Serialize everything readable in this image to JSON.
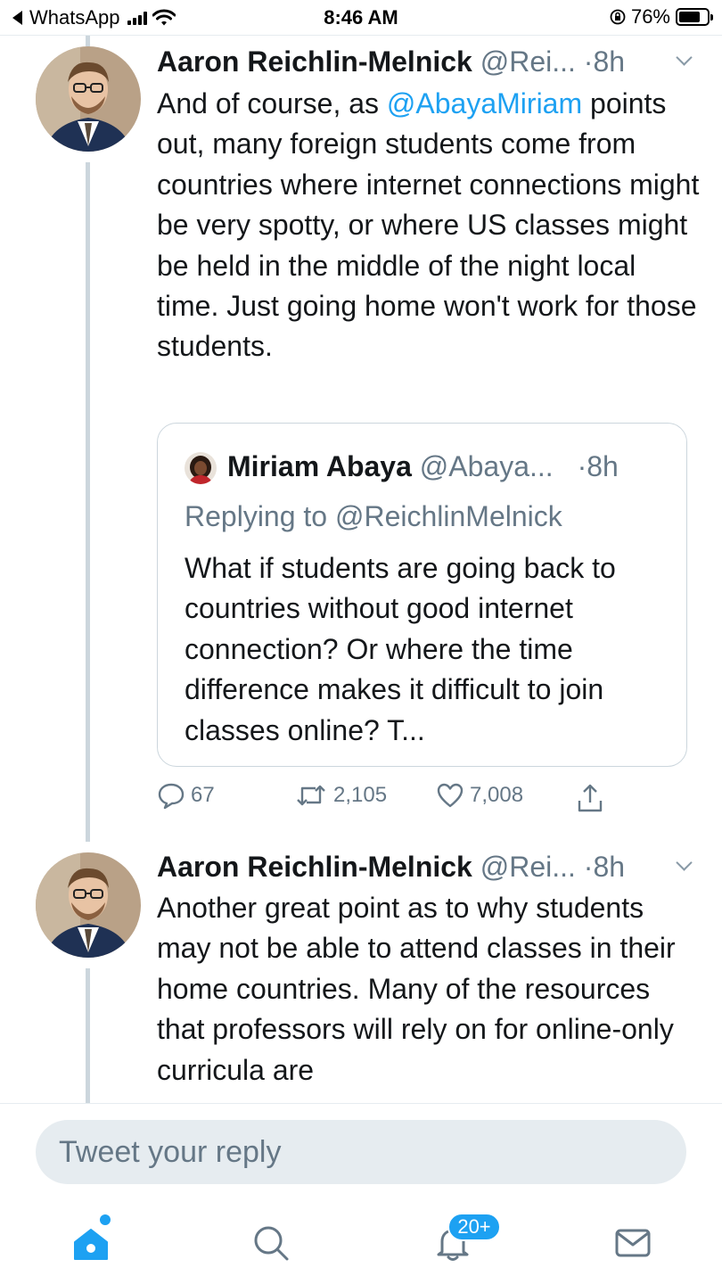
{
  "status_bar": {
    "back_app": "WhatsApp",
    "time": "8:46 AM",
    "battery": "76%",
    "battery_level": 0.76
  },
  "tweets": [
    {
      "name": "Aaron Reichlin-Melnick",
      "handle": "@Rei...",
      "time": "·8h",
      "text_before": "And of course, as ",
      "mention": "@AbayaMiriam",
      "text_after": " points out, many foreign students come from countries where internet connections might be very spotty, or where US classes might be held in the middle of the night local time. Just going home won't work for those students.",
      "quote": {
        "name": "Miriam Abaya",
        "handle": "@Abaya...",
        "time": "·8h",
        "replying_to": "Replying to @ReichlinMelnick",
        "text": "What if students are going back to countries without good internet connection? Or where the time difference makes it difficult to join classes online? T..."
      },
      "actions": {
        "replies": "67",
        "retweets": "2,105",
        "likes": "7,008"
      }
    },
    {
      "name": "Aaron Reichlin-Melnick",
      "handle": "@Rei...",
      "time": "·8h",
      "text": "Another great point as to why students may not be able to attend classes in their home countries. Many of the resources that professors will rely on for online-only curricula are"
    }
  ],
  "reply": {
    "placeholder": "Tweet your reply"
  },
  "tab_bar": {
    "notifications_badge": "20+"
  },
  "colors": {
    "accent": "#1da1f2",
    "secondary_text": "#657786",
    "border": "#ccd6dd"
  }
}
